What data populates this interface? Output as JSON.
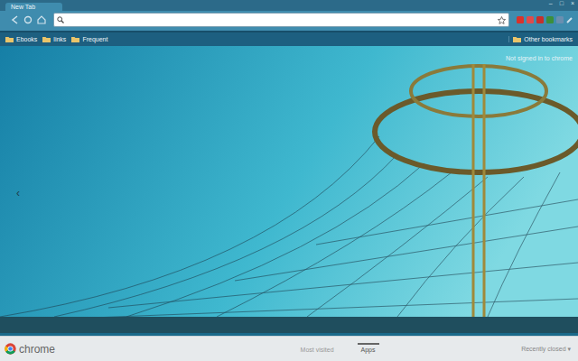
{
  "window": {
    "title": "New Tab",
    "controls": [
      "–",
      "□",
      "×"
    ]
  },
  "tabs": [
    {
      "label": "New Tab",
      "selected": true
    }
  ],
  "bookmarks": [
    {
      "label": "Ebooks"
    },
    {
      "label": "links"
    },
    {
      "label": "Frequent"
    }
  ],
  "other_bookmarks": "Other bookmarks",
  "sign_in": "Not signed in to chrome",
  "pager": {
    "prev": "‹"
  },
  "footer": {
    "logo": "chrome",
    "sections": [
      {
        "label": "Most visited",
        "selected": false
      },
      {
        "label": "Apps",
        "selected": true
      }
    ],
    "recently_closed": "Recently closed"
  }
}
